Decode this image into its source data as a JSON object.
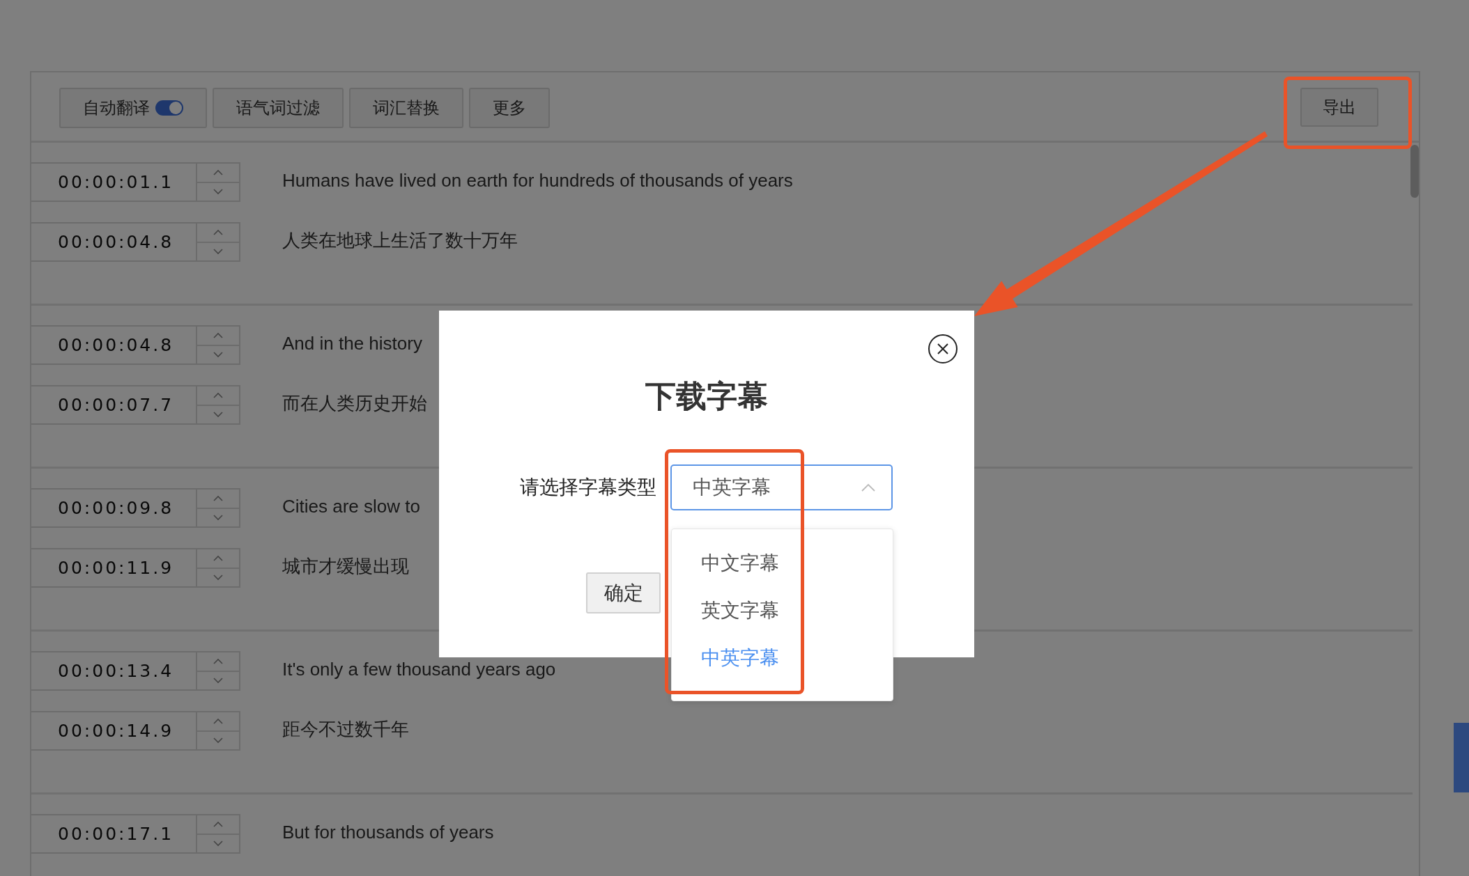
{
  "toolbar": {
    "toggle": {
      "label": "自动翻译",
      "on": true
    },
    "buttons": [
      "语气词过滤",
      "词汇替换",
      "更多"
    ],
    "export_button": "导出"
  },
  "subtitle_groups": [
    {
      "rows": [
        {
          "time": "00:00:01.1",
          "text": "Humans have lived on earth for hundreds of thousands of years"
        },
        {
          "time": "00:00:04.8",
          "text": "人类在地球上生活了数十万年"
        }
      ]
    },
    {
      "rows": [
        {
          "time": "00:00:04.8",
          "text": "And in the history"
        },
        {
          "time": "00:00:07.7",
          "text": "而在人类历史开始"
        }
      ]
    },
    {
      "rows": [
        {
          "time": "00:00:09.8",
          "text": "Cities are slow to"
        },
        {
          "time": "00:00:11.9",
          "text": "城市才缓慢出现"
        }
      ]
    },
    {
      "rows": [
        {
          "time": "00:00:13.4",
          "text": "It's only a few thousand years ago"
        },
        {
          "time": "00:00:14.9",
          "text": "距今不过数千年"
        }
      ]
    },
    {
      "rows": [
        {
          "time": "00:00:17.1",
          "text": "But for thousands of years"
        }
      ]
    }
  ],
  "dialog": {
    "title": "下载字幕",
    "field_label": "请选择字幕类型",
    "select": {
      "value": "中英字幕",
      "expanded": true,
      "options": [
        {
          "label": "中文字幕",
          "selected": false
        },
        {
          "label": "英文字幕",
          "selected": false
        },
        {
          "label": "中英字幕",
          "selected": true
        }
      ]
    },
    "confirm_button": "确定"
  }
}
